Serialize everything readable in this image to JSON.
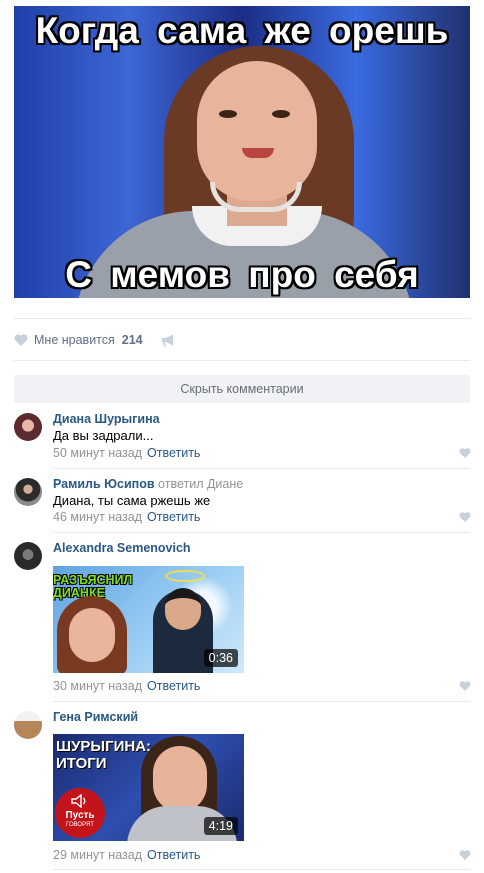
{
  "post": {
    "caption_top": "Когда сама же орешь",
    "caption_bottom": "С мемов про себя",
    "likes_label": "Мне нравится",
    "likes_count": "214",
    "hide_comments": "Скрыть комментарии"
  },
  "comments": [
    {
      "author": "Диана Шурыгина",
      "text": "Да вы задрали...",
      "time": "50 минут назад",
      "reply": "Ответить"
    },
    {
      "author": "Рамиль Юсипов",
      "replied_to": "ответил Диане",
      "text": "Диана, ты сама ржешь же",
      "time": "46 минут назад",
      "reply": "Ответить"
    },
    {
      "author": "Alexandra Semenovich",
      "video_title_lines": [
        "РАЗЪЯСНИЛ",
        "ДИАНКЕ"
      ],
      "duration": "0:36",
      "time": "30 минут назад",
      "reply": "Ответить"
    },
    {
      "author": "Гена Римский",
      "video_title_lines": [
        "ШУРЫГИНА:",
        "ИТОГИ"
      ],
      "logo_text": [
        "Пусть",
        "ГОВОРЯТ"
      ],
      "duration": "4:19",
      "time": "29 минут назад",
      "reply": "Ответить"
    }
  ],
  "colors": {
    "link": "#2a5885",
    "meta": "#939393",
    "like_icon": "#c7d1dc",
    "divider": "#e7e8ec",
    "button_bg": "#f0f2f5"
  },
  "icons": [
    "heart-icon",
    "megaphone-icon"
  ]
}
